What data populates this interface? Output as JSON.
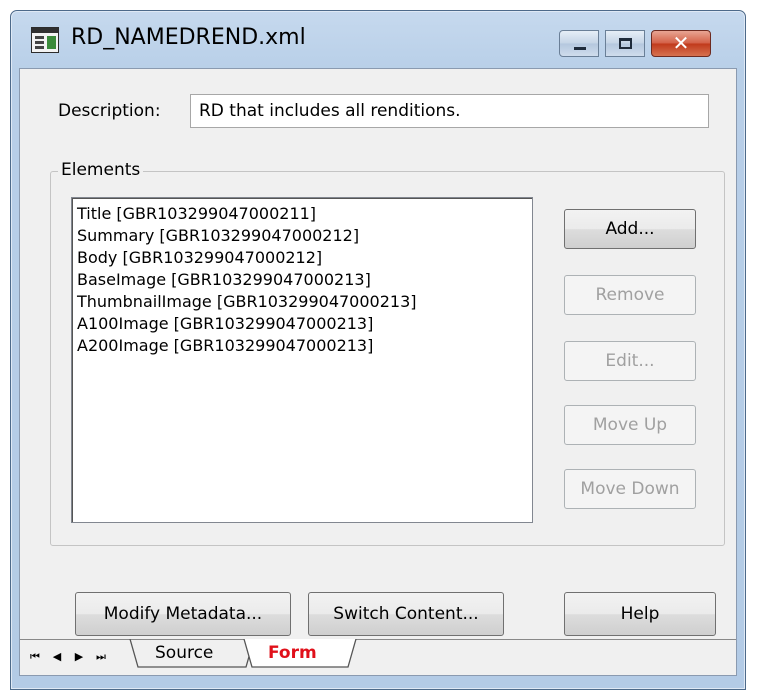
{
  "window": {
    "title": "RD_NAMEDREND.xml",
    "app_icon": "xml-form-editor-icon",
    "caption_buttons": {
      "minimize_icon": "minimize-icon",
      "maximize_icon": "maximize-icon",
      "close_icon": "close-icon",
      "close_glyph": "✕"
    }
  },
  "form": {
    "description_label": "Description:",
    "description_value": "RD that includes all renditions.",
    "elements_group_label": "Elements",
    "elements": [
      "Title [GBR103299047000211]",
      "Summary [GBR103299047000212]",
      "Body [GBR103299047000212]",
      "BaseImage [GBR103299047000213]",
      "ThumbnailImage [GBR103299047000213]",
      "A100Image [GBR103299047000213]",
      "A200Image [GBR103299047000213]"
    ],
    "buttons": {
      "add": "Add...",
      "remove": "Remove",
      "edit": "Edit...",
      "move_up": "Move Up",
      "move_down": "Move Down",
      "modify_metadata": "Modify Metadata...",
      "switch_content": "Switch Content...",
      "help": "Help"
    }
  },
  "tabs": {
    "nav": {
      "first": "⏮",
      "prev": "◀",
      "next": "▶",
      "last": "⏭"
    },
    "items": [
      {
        "label": "Source",
        "active": false
      },
      {
        "label": "Form",
        "active": true
      }
    ],
    "active_color": "#e0101a"
  }
}
